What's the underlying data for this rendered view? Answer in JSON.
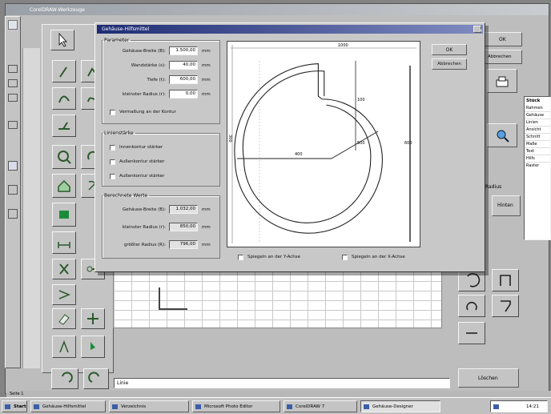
{
  "app": {
    "title": "CorelDRAW-Werkzeuge"
  },
  "dialog": {
    "title": "Gehäuse-Hilfsmittel",
    "close": "×",
    "parameters": {
      "legend": "Parameter",
      "rows": [
        {
          "label": "Gehäuse-Breite (B):",
          "value": "1.500,00",
          "unit": "mm"
        },
        {
          "label": "Wandstärke (s):",
          "value": "40,00",
          "unit": "mm"
        },
        {
          "label": "Tiefe (t):",
          "value": "600,00",
          "unit": "mm"
        },
        {
          "label": "kleinster Radius (r):",
          "value": "0,00",
          "unit": "mm"
        }
      ],
      "checkbox": "Vermaßung an der Kontur"
    },
    "options": {
      "legend": "Linienstärke",
      "items": [
        "Innenkontur stärker",
        "Außenkontur stärker",
        "Außenkontur stärker"
      ]
    },
    "results": {
      "legend": "Berechnete Werte",
      "rows": [
        {
          "label": "Gehäuse-Breite (B):",
          "value": "1.032,00",
          "unit": "mm"
        },
        {
          "label": "kleinster Radius (r):",
          "value": "850,00",
          "unit": "mm"
        },
        {
          "label": "größter Radius (R):",
          "value": "796,00",
          "unit": "mm"
        }
      ]
    },
    "preview": {
      "top_label": "1000",
      "left_label": "300",
      "mid_label": "400",
      "diag_label": "500",
      "right_label": "600",
      "small_label": "100",
      "checks": [
        "Spiegeln an der Y-Achse",
        "Spiegeln an der X-Achse"
      ]
    },
    "buttons": {
      "ok": "OK",
      "cancel": "Abbrechen"
    }
  },
  "bg_right": {
    "button_top": "OK",
    "button_cancel": "Abbrechen",
    "panel_label": "Ebene",
    "list_header": "Stück",
    "list_items": [
      "Rahmen",
      "Gehäuse",
      "Linien",
      "Ansicht",
      "Schnitt",
      "Maße",
      "Text",
      "Hilfs",
      "Raster"
    ],
    "label_r": "Radius",
    "btn_hinten": "Hinten",
    "btn_loeschen": "Löschen"
  },
  "status": {
    "input": "Linie",
    "tab_label": "Seite 1"
  },
  "taskbar": {
    "start": "Start",
    "tasks": [
      "Gehäuse-Hilfsmittel",
      "Verzeichnis",
      "Microsoft Photo Editor",
      "CorelDRAW 7",
      "Gehäuse-Designer"
    ],
    "clock": "14:21"
  }
}
